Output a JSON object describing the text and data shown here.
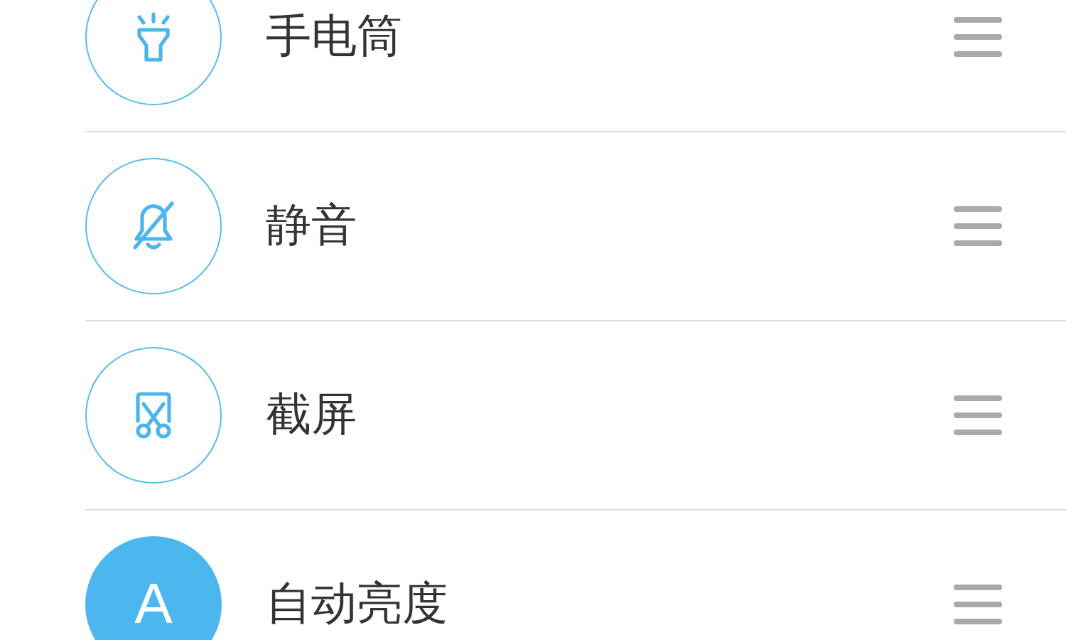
{
  "items": [
    {
      "kind": "flashlight",
      "label": "手电筒",
      "on": false
    },
    {
      "kind": "mute",
      "label": "静音",
      "on": false
    },
    {
      "kind": "screenshot",
      "label": "截屏",
      "on": false
    },
    {
      "kind": "letter",
      "glyph": "A",
      "label": "自动亮度",
      "on": true
    }
  ]
}
